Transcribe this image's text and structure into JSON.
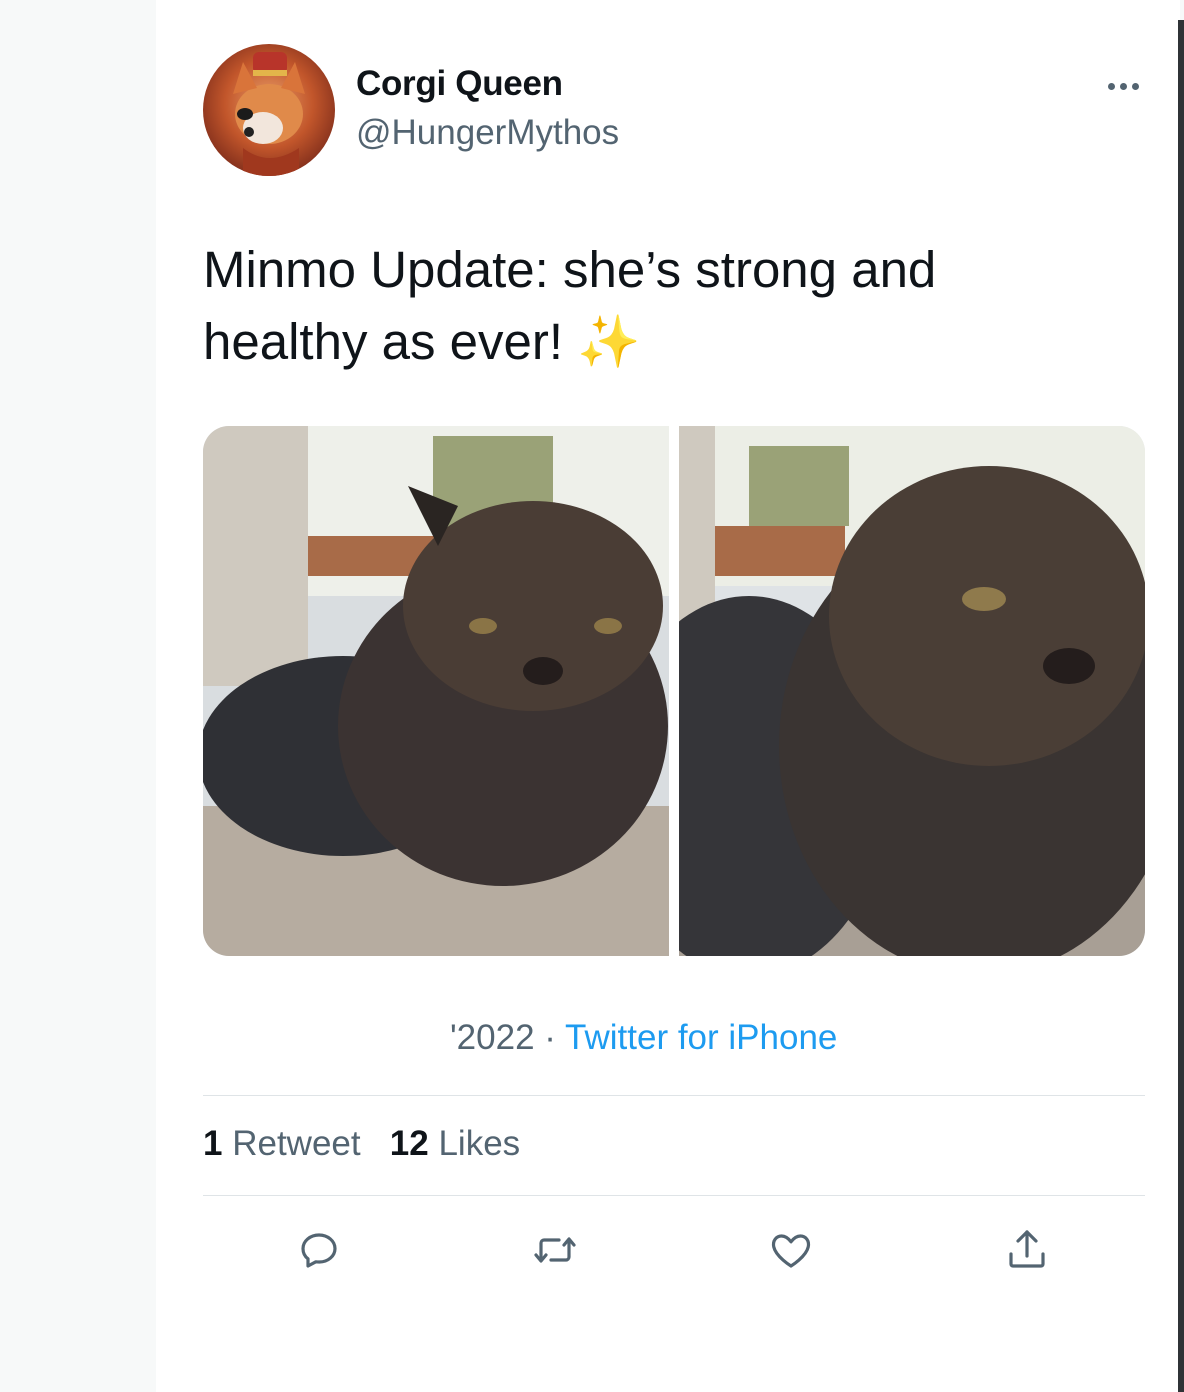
{
  "tweet": {
    "author_name": "Corgi Queen",
    "author_handle": "@HungerMythos",
    "text": "Minmo Update: she’s strong and healthy as ever! ✨",
    "date": "'2022",
    "separator": "·",
    "source": "Twitter for iPhone"
  },
  "stats": {
    "retweets_count": "1",
    "retweets_label": "Retweet",
    "likes_count": "12",
    "likes_label": "Likes"
  },
  "icons": {
    "more": "more-options-icon",
    "reply": "reply-icon",
    "retweet": "retweet-icon",
    "like": "heart-icon",
    "share": "share-icon"
  },
  "colors": {
    "text_primary": "#0f1419",
    "text_secondary": "#536471",
    "link": "#1d9bf0",
    "divider": "#dfe4e7"
  }
}
